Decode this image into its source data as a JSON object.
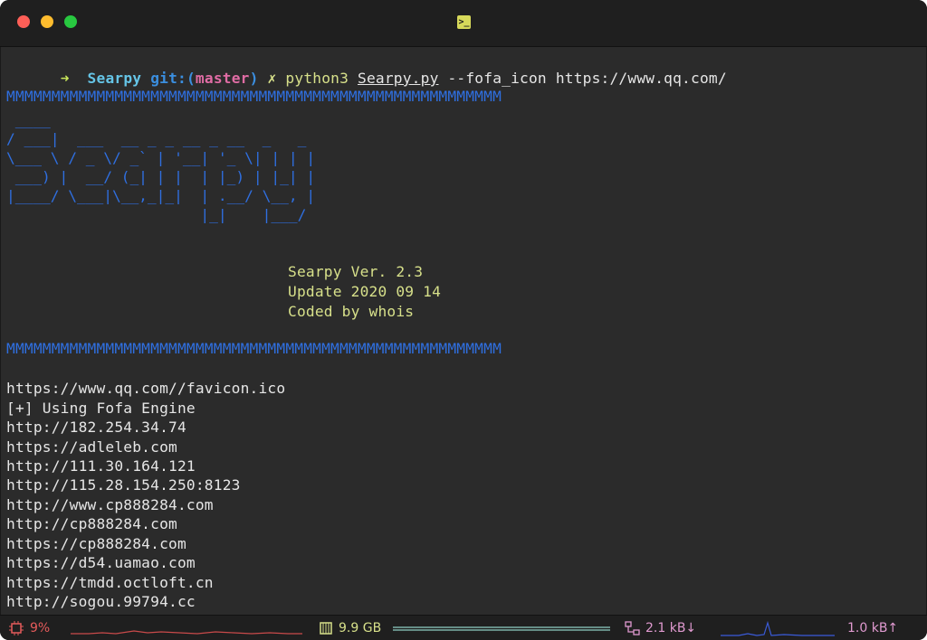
{
  "window": {
    "prompt": {
      "arrow": "➜",
      "dir": "Searpy",
      "git_prefix": "git:(",
      "branch": "master",
      "git_suffix": ")",
      "dirty": "✗",
      "cmd": "python3",
      "file": "Searpy.py",
      "args": "--fofa_icon https://www.qq.com/"
    }
  },
  "banner": {
    "rule": "MMMMMMMMMMMMMMMMMMMMMMMMMMMMMMMMMMMMMMMMMMMMMMMMMMMMMMM",
    "ascii_art": " ____\n/ ___|  ___  __ _ _ __ _ __  _   _\n\\___ \\ / _ \\/ _` | '__| '_ \\| | | |\n ___) |  __/ (_| | |  | |_) | |_| |\n|____/ \\___|\\__,_|_|  | .__/ \\__, |\n                      |_|    |___/",
    "version": "Searpy Ver. 2.3",
    "update": "Update 2020 09 14",
    "coded": "Coded by whois"
  },
  "output": [
    "https://www.qq.com//favicon.ico",
    "[+] Using Fofa Engine",
    "http://182.254.34.74",
    "https://adleleb.com",
    "http://111.30.164.121",
    "http://115.28.154.250:8123",
    "http://www.cp888284.com",
    "http://cp888284.com",
    "https://cp888284.com",
    "https://d54.uamao.com",
    "https://tmdd.octloft.cn",
    "http://sogou.99794.cc"
  ],
  "status": {
    "cpu": "9%",
    "mem": "9.9 GB",
    "net_down": "2.1 kB↓",
    "net_up": "1.0 kB↑",
    "cpu_icon": "cpu-chip-icon",
    "mem_icon": "memory-icon",
    "net_icon": "network-icon"
  },
  "colors": {
    "prompt_dir": "#65c4e6",
    "branch": "#e06ca4",
    "command": "#d7e08a",
    "banner": "#2f6fe0",
    "cpu": "#e55b5b",
    "net": "#e09ad0"
  }
}
